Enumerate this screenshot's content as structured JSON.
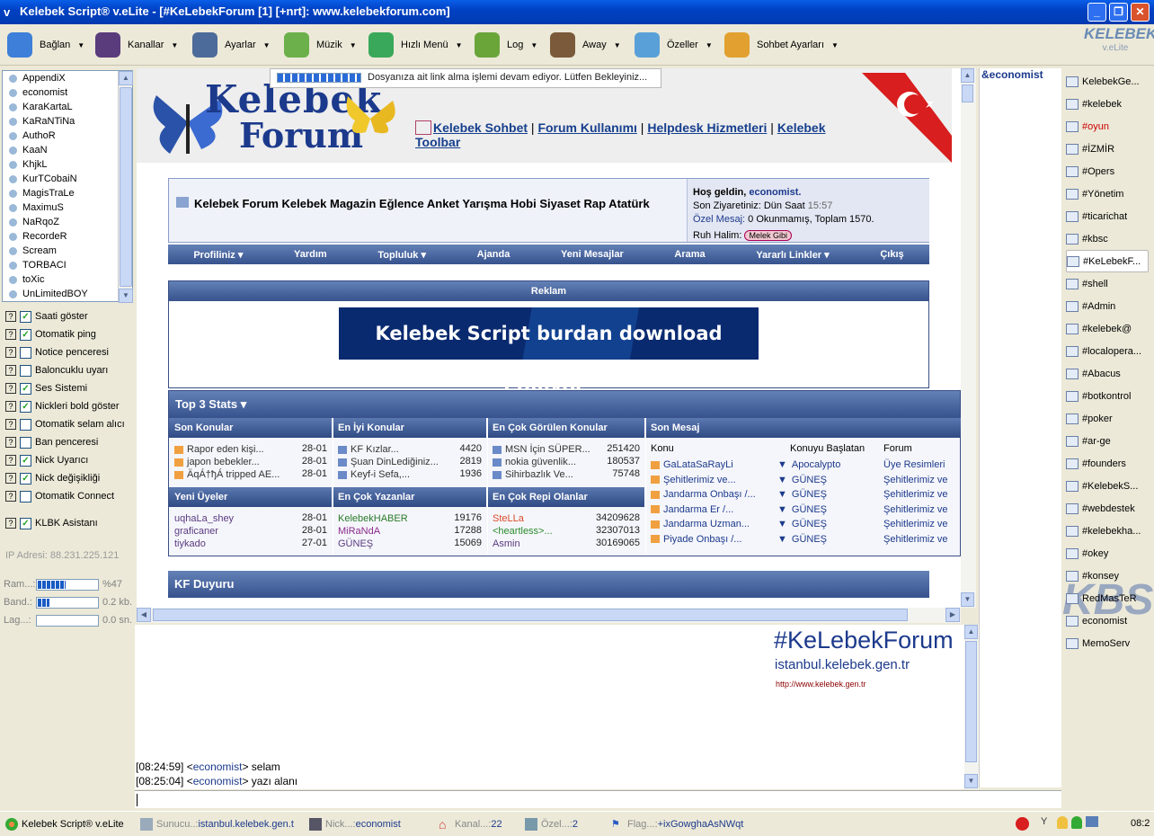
{
  "window": {
    "title": "Kelebek Script® v.eLite - [#KeLebekForum [1] [+nrt]:  www.kelebekforum.com]",
    "logo_text": "KELEBEK",
    "logo_sub": "v.eLite"
  },
  "toolbar": [
    {
      "label": "Bağlan",
      "color": "#3d7fd9"
    },
    {
      "label": "Kanallar",
      "color": "#5a3b7c"
    },
    {
      "label": "Ayarlar",
      "color": "#4d6b9a"
    },
    {
      "label": "Müzik",
      "color": "#6bb04a"
    },
    {
      "label": "Hızlı Menü",
      "color": "#3aa85a"
    },
    {
      "label": "Log",
      "color": "#6aa53a"
    },
    {
      "label": "Away",
      "color": "#7a5a3a"
    },
    {
      "label": "Özeller",
      "color": "#5aa0d8"
    },
    {
      "label": "Sohbet Ayarları",
      "color": "#e2a030"
    }
  ],
  "nicklist": [
    "AppendiX",
    "economist",
    "KaraKartaL",
    "KaRaNTiNa",
    "AuthoR",
    "KaaN",
    "KhjkL",
    "KurTCobaiN",
    "MagisTraLe",
    "MaximuS",
    "NaRqoZ",
    "RecordeR",
    "Scream",
    "TORBACI",
    "toXic",
    "UnLimitedBOY"
  ],
  "settings": [
    {
      "label": "Saati göster",
      "checked": "✓"
    },
    {
      "label": "Otomatik ping",
      "checked": "✓"
    },
    {
      "label": "Notice penceresi",
      "checked": ""
    },
    {
      "label": "Baloncuklu uyarı",
      "checked": ""
    },
    {
      "label": "Ses Sistemi",
      "checked": "✓"
    },
    {
      "label": "Nickleri bold göster",
      "checked": "✓"
    },
    {
      "label": "Otomatik selam alıcı",
      "checked": ""
    },
    {
      "label": "Ban penceresi",
      "checked": ""
    },
    {
      "label": "Nick Uyarıcı",
      "checked": "✓"
    },
    {
      "label": "Nick değişikliği",
      "checked": "✓"
    },
    {
      "label": "Otomatik Connect",
      "checked": ""
    },
    {
      "label": "KLBK Asistanı",
      "checked": "✓"
    }
  ],
  "ip_address": "IP Adresi: 88.231.225.121",
  "meters": [
    {
      "label": "Ram...:",
      "value": "%47",
      "fraction": 0.47
    },
    {
      "label": "Band.:",
      "value": "0.2 kb.",
      "fraction": 0.2
    },
    {
      "label": "Lag...:",
      "value": "0.0 sn.",
      "fraction": 0
    }
  ],
  "progress": {
    "text": "Dosyanıza ait link alma işlemi devam ediyor. Lütfen Bekleyiniz..."
  },
  "forum": {
    "logo_text": "Kelebek",
    "logo_sub": "Forum",
    "top_links": [
      "Kelebek Sohbet",
      "Forum Kullanımı",
      "Helpdesk Hizmetleri",
      "Kelebek Toolbar"
    ],
    "title": "Kelebek Forum Kelebek Magazin Eğlence Anket Yarışma Hobi Siyaset Rap Atatürk",
    "welcome": "Hoş geldin,",
    "user": "economist.",
    "last_visit": "Son Ziyaretiniz: Dün Saat",
    "last_visit_time": "15:57",
    "pm_label": "Özel Mesaj:",
    "pm_value": "0 Okunmamış, Toplam 1570.",
    "mood_label": "Ruh Halim:",
    "mood_value": "Melek Gibi",
    "nav": [
      "Profiliniz ▾",
      "Yardım",
      "Topluluk ▾",
      "Ajanda",
      "Yeni Mesajlar",
      "Arama",
      "Yararlı Linkler ▾",
      "Çıkış"
    ],
    "ad_header": "Reklam",
    "ad_banner": "Kelebek Script burdan download ediliyor!",
    "stats_header": "Top 3 Stats ▾",
    "stat_cols": [
      "Son Konular",
      "En İyi Konular",
      "En Çok Görülen Konular",
      "Son Mesaj"
    ],
    "son_konular": [
      {
        "t": "Rapor eden kişi...",
        "d": "28-01"
      },
      {
        "t": "japon bebekler...",
        "d": "28-01"
      },
      {
        "t": "ÄqÁ†ђÁ tripped AE...",
        "d": "28-01"
      }
    ],
    "en_iyi": [
      {
        "t": "KF Kızlar...",
        "n": "4420"
      },
      {
        "t": "Şuan DinLediğiniz...",
        "n": "2819"
      },
      {
        "t": "Keyf-i Sefa,...",
        "n": "1936"
      }
    ],
    "en_cok_gorulen": [
      {
        "t": "MSN İçin SÜPER...",
        "n": "251420"
      },
      {
        "t": "nokia güvenlik...",
        "n": "180537"
      },
      {
        "t": "Sihirbazlık Ve...",
        "n": "75748"
      }
    ],
    "son_mesaj_heads": [
      "Konu",
      "Konuyu Başlatan",
      "Forum"
    ],
    "son_mesaj": [
      {
        "k": "GaLataSaRayLi",
        "b": "Apocalypto",
        "f": "Üye Resimleri"
      },
      {
        "k": "Şehitlerimiz ve...",
        "b": "GÜNEŞ",
        "f": "Şehitlerimiz ve"
      },
      {
        "k": "Jandarma Onbaşı /...",
        "b": "GÜNEŞ",
        "f": "Şehitlerimiz ve"
      },
      {
        "k": "Jandarma Er /...",
        "b": "GÜNEŞ",
        "f": "Şehitlerimiz ve"
      },
      {
        "k": "Jandarma Uzman...",
        "b": "GÜNEŞ",
        "f": "Şehitlerimiz ve"
      },
      {
        "k": "Piyade Onbaşı /...",
        "b": "GÜNEŞ",
        "f": "Şehitlerimiz ve"
      }
    ],
    "stat_cols2": [
      "Yeni Üyeler",
      "En Çok Yazanlar",
      "En Çok Repi Olanlar"
    ],
    "yeni_uyeler": [
      {
        "t": "uqhaLa_shey",
        "d": "28-01"
      },
      {
        "t": "graficaner",
        "d": "28-01"
      },
      {
        "t": "tiykado",
        "d": "27-01"
      }
    ],
    "en_cok_yazan": [
      {
        "t": "KelebekHABER",
        "n": "19176"
      },
      {
        "t": "MiRaNdA",
        "n": "17288"
      },
      {
        "t": "GÜNEŞ",
        "n": "15069"
      }
    ],
    "en_cok_repi": [
      {
        "t": "SteLLa",
        "n": "34209628"
      },
      {
        "t": "<heartless>...",
        "n": "32307013"
      },
      {
        "t": "Asmin",
        "n": "30169065"
      }
    ],
    "duyuru": "KF Duyuru"
  },
  "channel_header": "&economist",
  "channels": [
    "KelebekGe...",
    "#kelebek",
    "#oyun",
    "#İZMİR",
    "#Opers",
    "#Yönetim",
    "#ticarichat",
    "#kbsc",
    "#KeLebekF...",
    "#shell",
    "#Admin",
    "#kelebek@",
    "#localopera...",
    "#Abacus",
    "#botkontrol",
    "#poker",
    "#ar-ge",
    "#founders",
    "#KelebekS...",
    "#webdestek",
    "#kelebekha...",
    "#okey",
    "#konsey",
    "RedMasTeR",
    "economist",
    "MemoServ"
  ],
  "banner": {
    "title": "#KeLebekForum",
    "server": "istanbul.kelebek.gen.tr",
    "url": "http://www.kelebek.gen.tr"
  },
  "chat": [
    {
      "time": "[08:24:59]",
      "nick": "economist",
      "msg": "selam"
    },
    {
      "time": "[08:25:04]",
      "nick": "economist",
      "msg": "yazı alanı"
    }
  ],
  "status": {
    "app": "Kelebek Script® v.eLite",
    "server_k": "Sunucu..:",
    "server_v": "istanbul.kelebek.gen.tr",
    "nick_k": "Nick...:",
    "nick_v": "economist",
    "kanal_k": "Kanal...:",
    "kanal_v": "22",
    "ozel_k": "Özel...:",
    "ozel_v": "2",
    "flag_k": "Flag...:",
    "flag_v": "+ixGowghaAsNWqt",
    "clock": "08:2"
  }
}
